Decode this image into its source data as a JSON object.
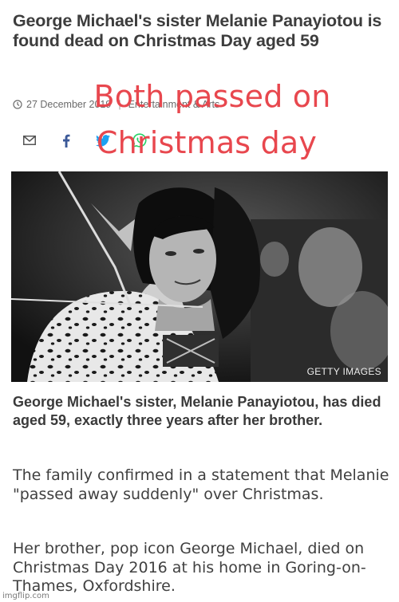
{
  "article": {
    "headline": "George Michael's sister Melanie Panayiotou is found dead on Christmas Day aged 59",
    "date": "27 December 2019",
    "category": "Entertainment & Arts",
    "photo_credit": "GETTY IMAGES",
    "lead": "George Michael's sister, Melanie Panayiotou, has died aged 59, exactly three years after her brother.",
    "paragraphs": [
      "The family confirmed in a statement that Melanie \"passed away suddenly\" over Christmas.",
      "Her brother, pop icon George Michael, died on Christmas Day 2016 at his home in Goring-on-Thames, Oxfordshire."
    ]
  },
  "share_icons": [
    "email-icon",
    "facebook-icon",
    "twitter-icon",
    "whatsapp-icon"
  ],
  "overlay": {
    "line1": "Both passed on",
    "line2": "Christmas day",
    "color": "#e8474e"
  },
  "watermark": "imgflip.com"
}
